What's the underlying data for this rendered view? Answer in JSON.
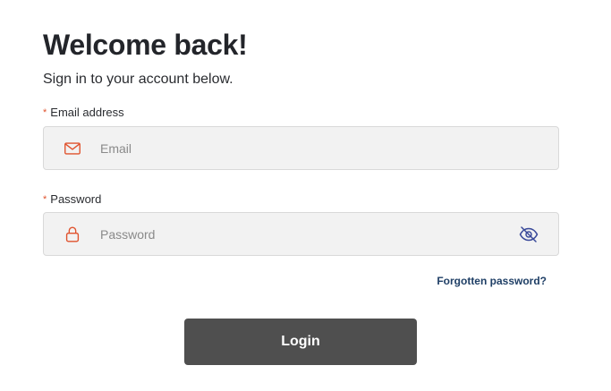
{
  "header": {
    "title": "Welcome back!",
    "subtitle": "Sign in to your account below."
  },
  "form": {
    "email": {
      "label": "Email address",
      "required_marker": "*",
      "placeholder": "Email",
      "value": "",
      "icon": "envelope-icon"
    },
    "password": {
      "label": "Password",
      "required_marker": "*",
      "placeholder": "Password",
      "value": "",
      "icon": "lock-icon",
      "toggle_icon": "eye-off-icon"
    },
    "forgot_link": "Forgotten password?",
    "submit_label": "Login"
  },
  "colors": {
    "accent": "#e0522d",
    "link": "#1f3f66",
    "toggle": "#3a4a9a",
    "button_bg": "#4f4f4f",
    "field_bg": "#f2f2f2"
  }
}
